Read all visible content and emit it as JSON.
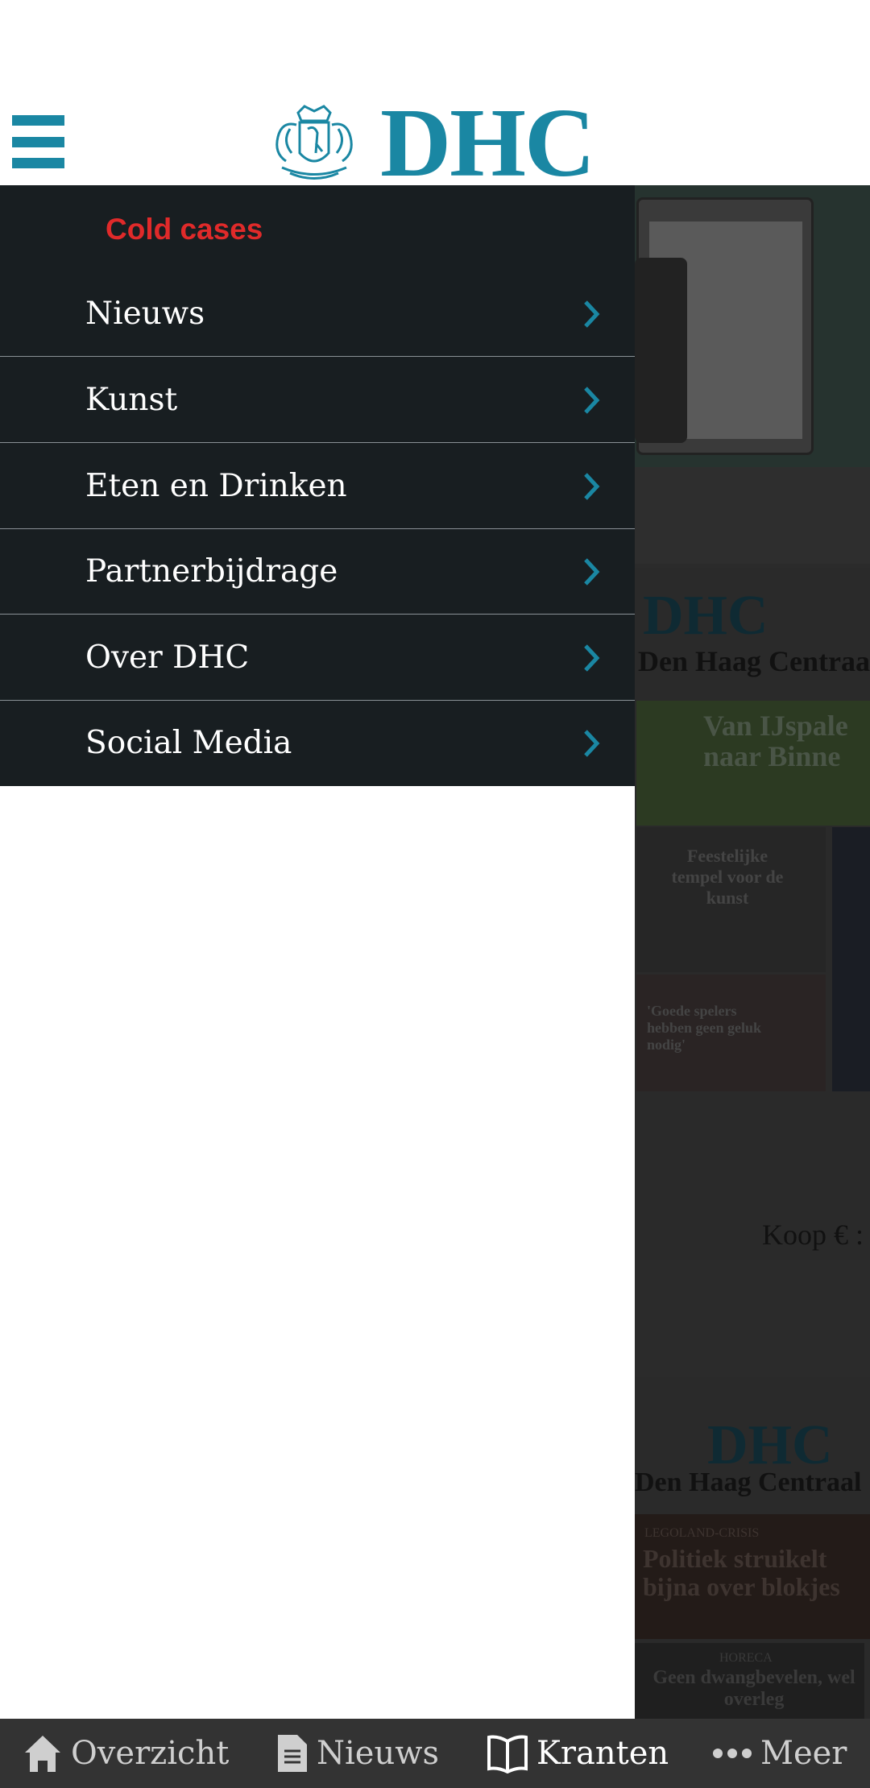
{
  "header": {
    "logo_text": "DHC",
    "brand_color": "#1a87a3"
  },
  "drawer": {
    "section_title": "Cold cases",
    "items": [
      {
        "label": "Nieuws"
      },
      {
        "label": "Kunst"
      },
      {
        "label": "Eten en Drinken"
      },
      {
        "label": "Partnerbijdrage"
      },
      {
        "label": "Over DHC"
      },
      {
        "label": "Social Media"
      }
    ]
  },
  "background": {
    "paper1_title": "Den Haag Centraal",
    "paper1_headline": "Van IJspale naar Binne",
    "paper1_story1": "Feestelijke tempel voor de kunst",
    "paper1_story2": "'Goede spelers hebben geen geluk nodig'",
    "buy_text": "Koop € :",
    "paper2_title": "Den Haag Centraal",
    "paper2_kicker": "LEGOLAND-CRISIS",
    "paper2_headline": "Politiek struikelt bijna over blokjes",
    "paper2_kicker2": "HORECA",
    "paper2_story": "Geen dwangbevelen, wel overleg"
  },
  "bottom_nav": [
    {
      "label": "Overzicht",
      "icon": "home-icon"
    },
    {
      "label": "Nieuws",
      "icon": "document-icon"
    },
    {
      "label": "Kranten",
      "icon": "book-icon",
      "active": true
    },
    {
      "label": "Meer",
      "icon": "more-icon"
    }
  ]
}
